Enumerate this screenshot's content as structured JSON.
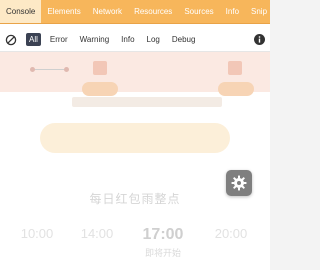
{
  "devtools": {
    "tabs": [
      {
        "label": "Console",
        "active": true
      },
      {
        "label": "Elements",
        "active": false
      },
      {
        "label": "Network",
        "active": false
      },
      {
        "label": "Resources",
        "active": false
      },
      {
        "label": "Sources",
        "active": false
      },
      {
        "label": "Info",
        "active": false
      },
      {
        "label": "Snip",
        "active": false
      }
    ],
    "filters": [
      {
        "label": "All",
        "active": true
      },
      {
        "label": "Error",
        "active": false
      },
      {
        "label": "Warning",
        "active": false
      },
      {
        "label": "Info",
        "active": false
      },
      {
        "label": "Log",
        "active": false
      },
      {
        "label": "Debug",
        "active": false
      }
    ],
    "accent": "#f7b65b",
    "active_filter_color": "#3b4253",
    "icons": {
      "clear": "clear-console-icon",
      "info": "info-icon",
      "settings": "gear-icon"
    }
  },
  "background_app": {
    "section_title": "每日红包雨整点",
    "times": [
      {
        "time": "10:00",
        "status": ""
      },
      {
        "time": "14:00",
        "status": ""
      },
      {
        "time": "17:00",
        "status": "即将开始"
      },
      {
        "time": "20:00",
        "status": ""
      }
    ]
  }
}
